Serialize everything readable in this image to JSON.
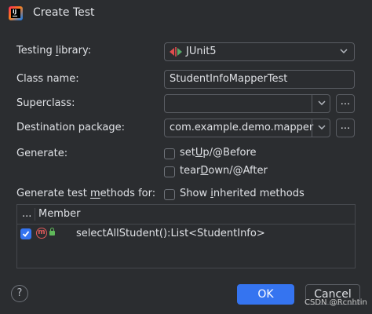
{
  "dialog": {
    "title": "Create Test"
  },
  "labels": {
    "testing_library": {
      "pre": "Testing ",
      "acc": "l",
      "post": "ibrary:"
    },
    "class_name": "Class name:",
    "superclass": "Superclass:",
    "destination_package": "Destination package:",
    "generate": "Generate:",
    "generate_methods": {
      "pre": "Generate test ",
      "acc": "m",
      "post": "ethods for:"
    }
  },
  "testing_library": {
    "value": "JUnit5",
    "icon": "junit-icon"
  },
  "class_name": {
    "value": "StudentInfoMapperTest"
  },
  "superclass": {
    "value": ""
  },
  "destination_package": {
    "value": "com.example.demo.mapper"
  },
  "browse_label": "...",
  "generate_options": [
    {
      "pre": "set",
      "acc": "U",
      "post": "p/@Before",
      "checked": false
    },
    {
      "pre": "tear",
      "acc": "D",
      "post": "own/@After",
      "checked": false
    }
  ],
  "show_inherited": {
    "pre": "Show ",
    "acc": "i",
    "post": "nherited methods",
    "checked": false
  },
  "members_table": {
    "col_check": "...",
    "col_member": "Member",
    "rows": [
      {
        "checked": true,
        "icon": "method-icon",
        "access_icon": "public-lock-icon",
        "signature": "selectAllStudent():List<StudentInfo>"
      }
    ]
  },
  "buttons": {
    "help": "?",
    "ok": "OK",
    "cancel": "Cancel"
  },
  "watermark": "CSDN @Rcnhtin",
  "colors": {
    "background": "#2b2d30",
    "accent": "#3574f0",
    "text": "#dfe1e5"
  }
}
